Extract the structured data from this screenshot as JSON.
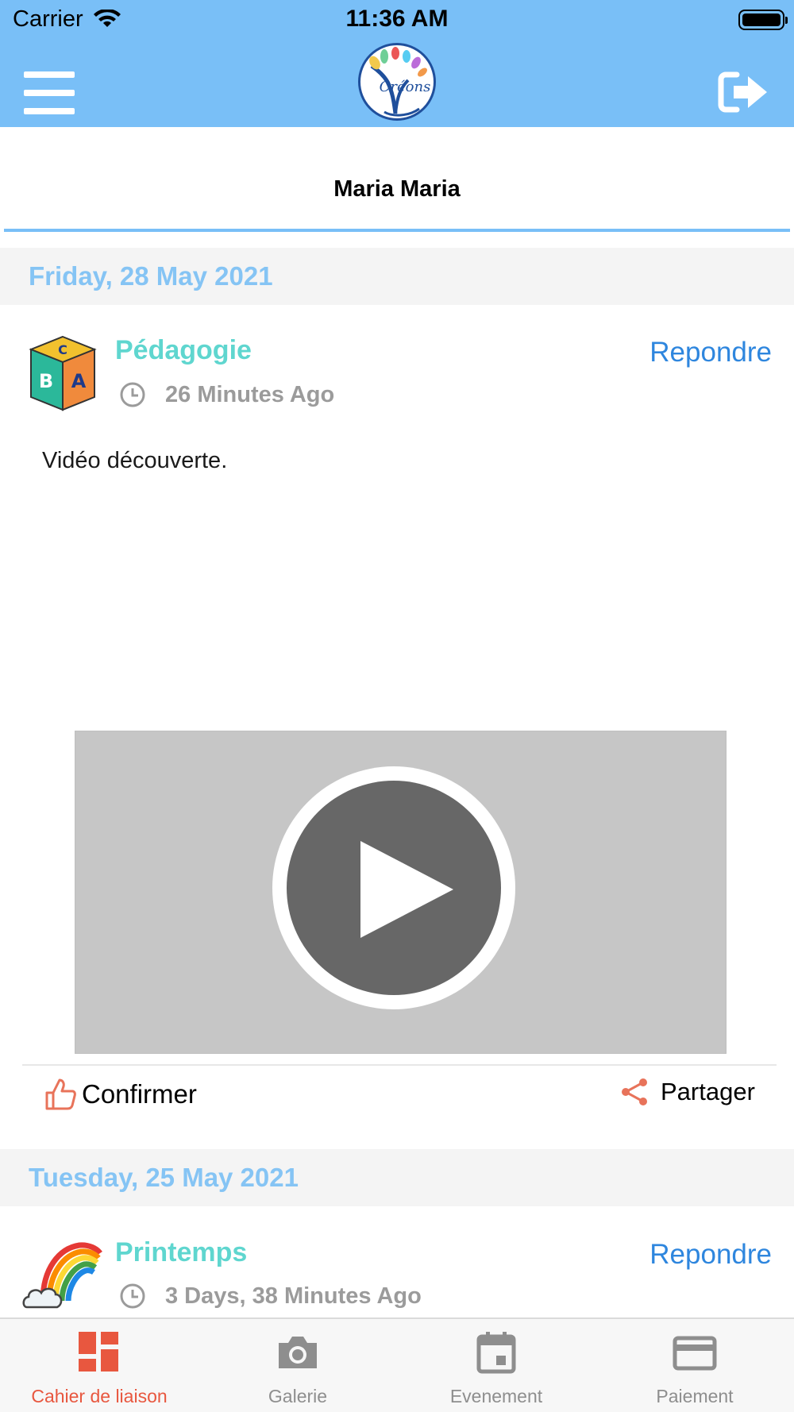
{
  "status_bar": {
    "carrier": "Carrier",
    "time": "11:36 AM"
  },
  "header": {
    "menu_icon": "hamburger-icon",
    "logo_text": "Créons",
    "logout_icon": "logout-icon",
    "background_color": "#79bff7"
  },
  "page": {
    "title": "Maria Maria"
  },
  "feed": [
    {
      "date": "Friday, 28 May 2021",
      "category": "Pédagogie",
      "icon": "abc-blocks-icon",
      "time_ago": "26 Minutes Ago",
      "reply_label": "Repondre",
      "text": "Vidéo découverte.",
      "media": "video-player",
      "confirm_label": "Confirmer",
      "share_label": "Partager"
    },
    {
      "date": "Tuesday, 25 May 2021",
      "category": "Printemps",
      "icon": "rainbow-icon",
      "time_ago": "3 Days, 38 Minutes Ago",
      "reply_label": "Repondre"
    }
  ],
  "tabbar": {
    "items": [
      {
        "label": "Cahier de liaison",
        "icon": "dashboard-icon",
        "active": true
      },
      {
        "label": "Galerie",
        "icon": "camera-icon",
        "active": false
      },
      {
        "label": "Evenement",
        "icon": "calendar-icon",
        "active": false
      },
      {
        "label": "Paiement",
        "icon": "credit-card-icon",
        "active": false
      }
    ]
  },
  "colors": {
    "accent": "#79bff7",
    "date_text": "#85c4f4",
    "category_text": "#5fd6cf",
    "link": "#2e86de",
    "active_tab": "#e8573f",
    "inactive_tab": "#8e8e8e"
  }
}
